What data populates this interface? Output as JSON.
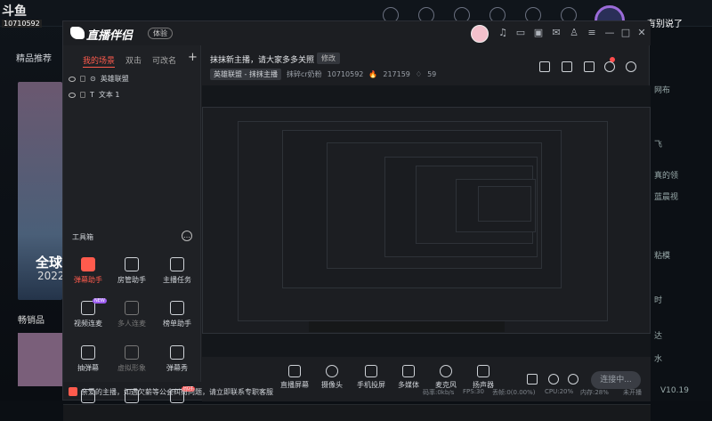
{
  "background": {
    "app_logo": "斗鱼",
    "room_id": "10710592",
    "left_tab": "精品推荐",
    "banner_title": "全球",
    "banner_year": "2022",
    "sold_label": "畅销品",
    "right_text": "有别说了",
    "right_items": [
      "网布",
      "飞",
      "真的领",
      "蓝晨视",
      "粘模",
      "时",
      "达",
      "水"
    ],
    "version": "V10.19"
  },
  "window": {
    "app_name": "直播伴侣",
    "beta_label": "体验"
  },
  "left_panel": {
    "tabs": [
      {
        "label": "我的场景",
        "active": true
      },
      {
        "label": "双击",
        "active": false
      },
      {
        "label": "可改名",
        "active": false
      }
    ],
    "add_label": "+",
    "scenes": [
      {
        "name": "英雄联盟"
      },
      {
        "name": "文本 1"
      }
    ],
    "toolbox_label": "工具箱",
    "more_label": "…",
    "tools": [
      {
        "label": "弹幕助手",
        "active": true
      },
      {
        "label": "房管助手"
      },
      {
        "label": "主播任务"
      },
      {
        "label": "视频连麦",
        "badge": "NEW"
      },
      {
        "label": "多人连麦",
        "dim": true
      },
      {
        "label": "榜单助手"
      },
      {
        "label": "抽弹幕"
      },
      {
        "label": "虚拟形象",
        "dim": true
      },
      {
        "label": "弹幕秀"
      },
      {
        "label": "",
        "badge": "HOT"
      }
    ]
  },
  "header": {
    "title": "抹抹新主播，请大家多多关照",
    "edit_label": "修改",
    "category": "英雄联盟 - 抹抹主播",
    "streamer": "抹碎cr奶粉",
    "room_no": "10710592",
    "popularity": "217159",
    "fans": "59"
  },
  "bottom": {
    "buttons": [
      "直播屏幕",
      "摄像头",
      "手机投屏",
      "多媒体",
      "麦克风",
      "扬声器"
    ],
    "live_label": "连接中..."
  },
  "status": {
    "notice": "亲爱的主播，如遇欠薪等公会纠纷问题，请立即联系专职客服",
    "stats": [
      "码率:0kb/s",
      "FPS:30",
      "丢帧:0(0.00%)",
      "CPU:20%",
      "内存:28%",
      "未开播"
    ]
  },
  "colors": {
    "accent": "#ff5b4d",
    "panel": "#1c1e22",
    "text": "#cfd3d8"
  }
}
